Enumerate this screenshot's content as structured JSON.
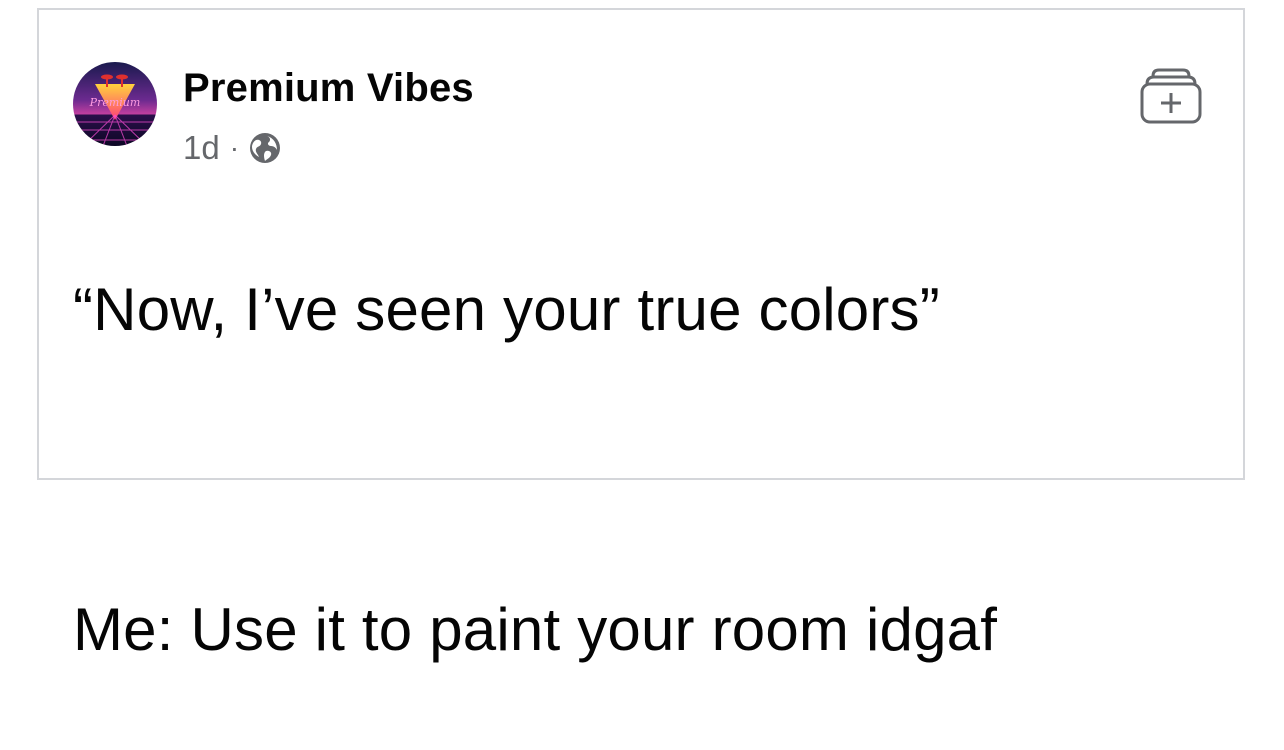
{
  "post": {
    "author": "Premium Vibes",
    "time": "1d",
    "separator": "·",
    "privacy_icon": "globe-icon",
    "avatar_text": "Premium",
    "save_icon": "collection-add-icon",
    "lines": [
      "“Now, I’ve seen your true colors”",
      "Me: Use it to paint your room idgaf"
    ]
  },
  "colors": {
    "text": "#050505",
    "muted": "#65676b",
    "border": "#d4d6da"
  }
}
